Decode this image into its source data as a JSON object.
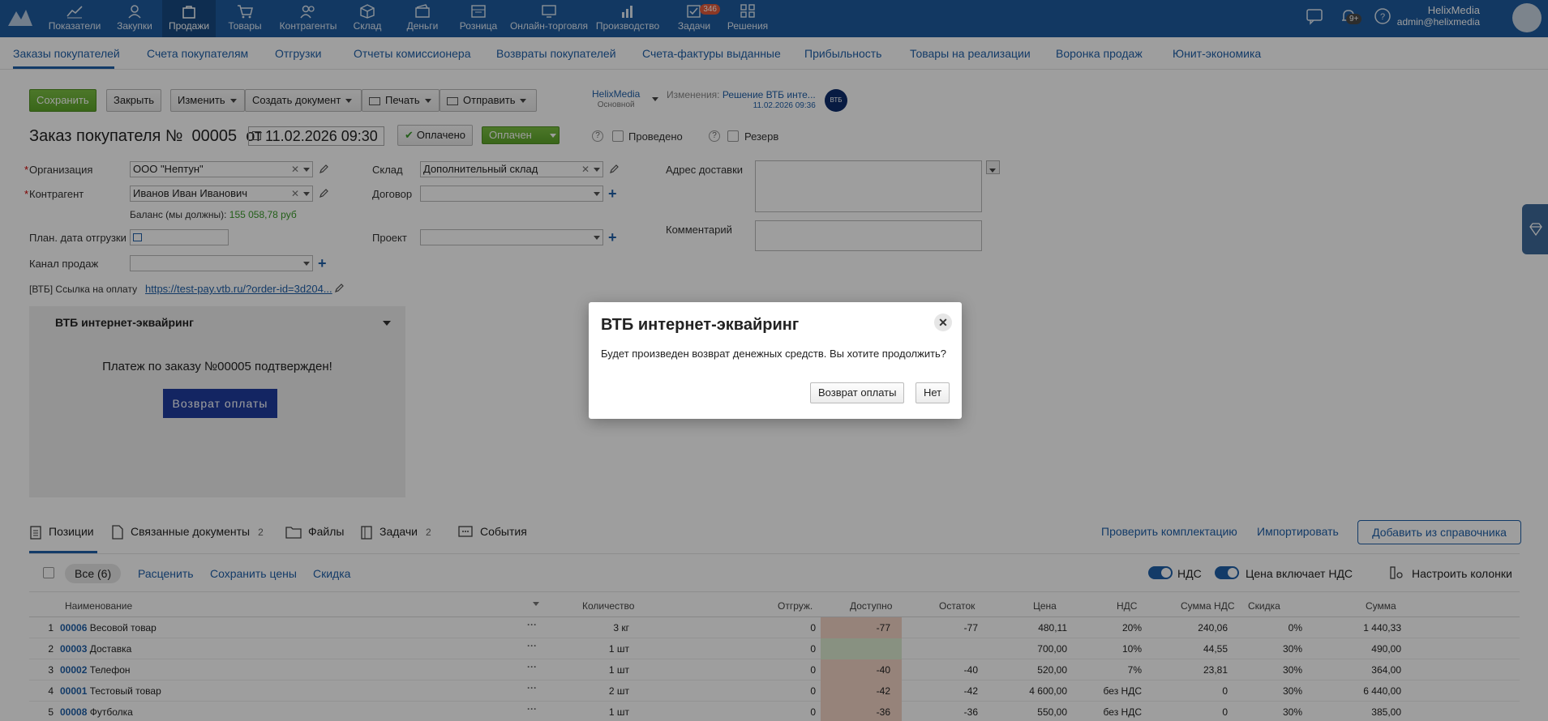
{
  "topnav": {
    "items": [
      {
        "label": "Показатели",
        "icon": "chart-line-icon"
      },
      {
        "label": "Закупки",
        "icon": "purchases-icon"
      },
      {
        "label": "Продажи",
        "icon": "bag-icon"
      },
      {
        "label": "Товары",
        "icon": "cart-icon"
      },
      {
        "label": "Контрагенты",
        "icon": "users-icon"
      },
      {
        "label": "Склад",
        "icon": "box-icon"
      },
      {
        "label": "Деньги",
        "icon": "wallet-icon"
      },
      {
        "label": "Розница",
        "icon": "store-icon"
      },
      {
        "label": "Онлайн-торговля",
        "icon": "online-icon"
      },
      {
        "label": "Производство",
        "icon": "factory-icon"
      },
      {
        "label": "Задачи",
        "icon": "tasks-icon",
        "badge": "346"
      },
      {
        "label": "Решения",
        "icon": "grid-icon"
      }
    ],
    "notifications_badge": "9+",
    "user_name": "HelixMedia",
    "user_email": "admin@helixmedia"
  },
  "subnav": {
    "items": [
      "Заказы покупателей",
      "Счета покупателям",
      "Отгрузки",
      "Отчеты комиссионера",
      "Возвраты покупателей",
      "Счета-фактуры выданные",
      "Прибыльность",
      "Товары на реализации",
      "Воронка продаж",
      "Юнит-экономика"
    ]
  },
  "toolbar": {
    "save": "Сохранить",
    "close": "Закрыть",
    "edit": "Изменить",
    "create_doc": "Создать документ",
    "print": "Печать",
    "send": "Отправить"
  },
  "org_switch": {
    "name": "HelixMedia",
    "sub": "Основной"
  },
  "changes": {
    "label": "Изменения:",
    "link": "Решение ВТБ инте...",
    "date": "11.02.2026 09:36",
    "badge": "ВТБ"
  },
  "doc": {
    "title": "Заказ покупателя №",
    "number": "00005",
    "from": "от",
    "date": "11.02.2026 09:30",
    "paid_btn": "Оплачено",
    "status": "Оплачен",
    "posted": "Проведено",
    "reserve": "Резерв"
  },
  "form": {
    "org_label": "Организация",
    "org_value": "ООО \"Нептун\"",
    "contractor_label": "Контрагент",
    "contractor_value": "Иванов Иван Иванович",
    "balance_label": "Баланс (мы должны):",
    "balance_value": "155 058,78 руб",
    "ship_date_label": "План. дата отгрузки",
    "channel_label": "Канал продаж",
    "vtb_link_label": "[ВТБ] Ссылка на оплату",
    "vtb_link_value": "https://test-pay.vtb.ru/?order-id=3d204...",
    "warehouse_label": "Склад",
    "warehouse_value": "Дополнительный склад",
    "contract_label": "Договор",
    "project_label": "Проект",
    "address_label": "Адрес доставки",
    "comment_label": "Комментарий"
  },
  "widget": {
    "title": "ВТБ интернет-эквайринг",
    "message": "Платеж по заказу №00005 подтвержден!",
    "button": "Возврат оплаты"
  },
  "tabs": [
    {
      "label": "Позиции",
      "count": ""
    },
    {
      "label": "Связанные документы",
      "count": "2"
    },
    {
      "label": "Файлы",
      "count": ""
    },
    {
      "label": "Задачи",
      "count": "2"
    },
    {
      "label": "События",
      "count": ""
    }
  ],
  "actions": {
    "check": "Проверить комплектацию",
    "import": "Импортировать",
    "add_from_catalog": "Добавить из справочника"
  },
  "filters": {
    "all": "Все (6)",
    "price": "Расценить",
    "save_prices": "Сохранить цены",
    "discount": "Скидка",
    "vat": "НДС",
    "price_incl_vat": "Цена включает НДС",
    "columns": "Настроить колонки"
  },
  "table": {
    "headers": [
      "Наименование",
      "Количество",
      "Отгруж.",
      "Доступно",
      "Остаток",
      "Цена",
      "НДС",
      "Сумма НДС",
      "Скидка",
      "Сумма"
    ],
    "rows": [
      {
        "n": "1",
        "code": "00006",
        "name": "Весовой товар",
        "qty": "3 кг",
        "shipped": "0",
        "avail": "-77",
        "rest": "-77",
        "price": "480,11",
        "vat": "20%",
        "vat_sum": "240,06",
        "disc": "0%",
        "sum": "1 440,33",
        "avail_color": "#f2d3c6"
      },
      {
        "n": "2",
        "code": "00003",
        "name": "Доставка",
        "qty": "1 шт",
        "shipped": "0",
        "avail": "",
        "rest": "",
        "price": "700,00",
        "vat": "10%",
        "vat_sum": "44,55",
        "disc": "30%",
        "sum": "490,00",
        "avail_color": "#dcebd0"
      },
      {
        "n": "3",
        "code": "00002",
        "name": "Телефон",
        "qty": "1 шт",
        "shipped": "0",
        "avail": "-40",
        "rest": "-40",
        "price": "520,00",
        "vat": "7%",
        "vat_sum": "23,81",
        "disc": "30%",
        "sum": "364,00",
        "avail_color": "#f2d3c6"
      },
      {
        "n": "4",
        "code": "00001",
        "name": "Тестовый товар",
        "qty": "2 шт",
        "shipped": "0",
        "avail": "-42",
        "rest": "-42",
        "price": "4 600,00",
        "vat": "без НДС",
        "vat_sum": "0",
        "disc": "30%",
        "sum": "6 440,00",
        "avail_color": "#f2d3c6"
      },
      {
        "n": "5",
        "code": "00008",
        "name": "Футболка",
        "qty": "1 шт",
        "shipped": "0",
        "avail": "-36",
        "rest": "-36",
        "price": "550,00",
        "vat": "без НДС",
        "vat_sum": "0",
        "disc": "30%",
        "sum": "385,00",
        "avail_color": "#f2d3c6"
      }
    ]
  },
  "modal": {
    "title": "ВТБ интернет-эквайринг",
    "text": "Будет произведен возврат денежных средств. Вы хотите продолжить?",
    "confirm": "Возврат оплаты",
    "cancel": "Нет"
  }
}
